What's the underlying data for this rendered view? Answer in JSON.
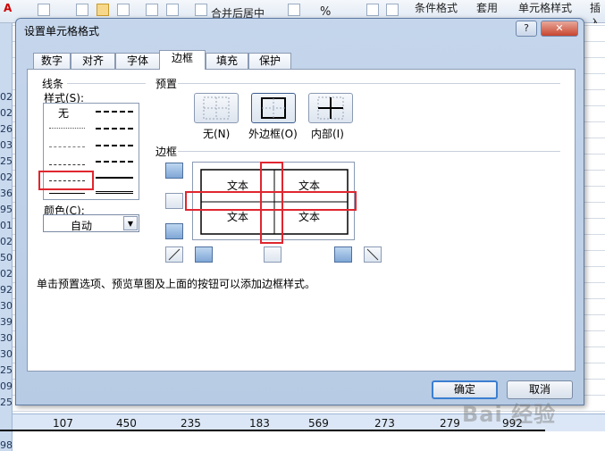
{
  "ribbon": {
    "items": [
      "合并后居中",
      "条件格式",
      "套用",
      "单元格样式",
      "插入"
    ],
    "number_format": "%"
  },
  "sheet": {
    "row_numbers": [
      "02",
      "02",
      "26",
      "03",
      "25",
      "02",
      "36",
      "95",
      "01",
      "02",
      "50",
      "02",
      "92",
      "30",
      "39",
      "30",
      "30",
      "25",
      "09",
      "25",
      "98"
    ],
    "bottom_values": [
      "107",
      "450",
      "235",
      "183",
      "569",
      "273",
      "279",
      "992"
    ]
  },
  "dialog": {
    "title": "设置单元格格式",
    "help": "?",
    "close": "✕",
    "tabs": [
      "数字",
      "对齐",
      "字体",
      "边框",
      "填充",
      "保护"
    ],
    "active_tab": "边框",
    "line": {
      "group_label": "线条",
      "style_label": "样式(S):",
      "none_label": "无",
      "color_label": "颜色(C):",
      "color_value": "自动"
    },
    "presets": {
      "group_label": "预置",
      "none": "无(N)",
      "outline": "外边框(O)",
      "inside": "内部(I)"
    },
    "border": {
      "group_label": "边框",
      "preview_text": "文本"
    },
    "hint": "单击预置选项、预览草图及上面的按钮可以添加边框样式。",
    "ok": "确定",
    "cancel": "取消"
  },
  "watermark": "Bai 经验"
}
